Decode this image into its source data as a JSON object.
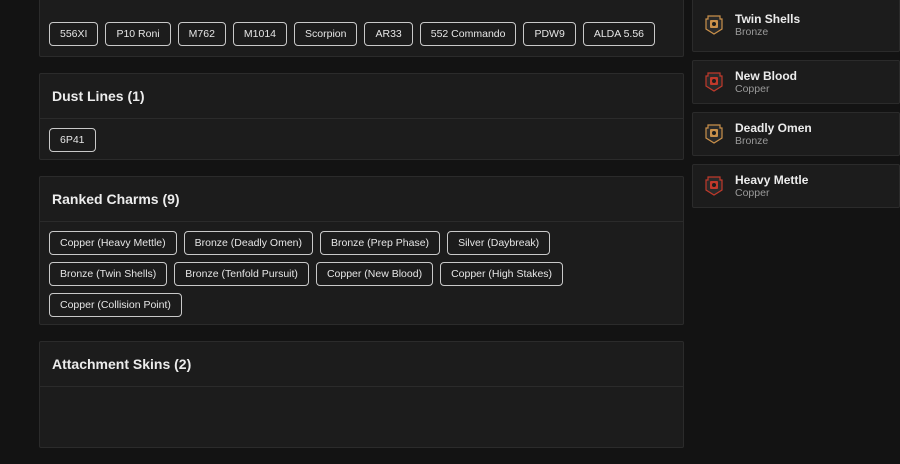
{
  "weapon_chips": [
    "556XI",
    "P10 Roni",
    "M762",
    "M1014",
    "Scorpion",
    "AR33",
    "552 Commando",
    "PDW9",
    "ALDA 5.56"
  ],
  "dust_lines": {
    "title": "Dust Lines (1)",
    "items": [
      "6P41"
    ]
  },
  "ranked_charms": {
    "title": "Ranked Charms (9)",
    "items": [
      "Copper (Heavy Mettle)",
      "Bronze (Deadly Omen)",
      "Bronze (Prep Phase)",
      "Silver (Daybreak)",
      "Bronze (Twin Shells)",
      "Bronze (Tenfold Pursuit)",
      "Copper (New Blood)",
      "Copper (High Stakes)",
      "Copper (Collision Point)"
    ]
  },
  "attachment_skins": {
    "title": "Attachment Skins (2)"
  },
  "right_list": [
    {
      "name": "Twin Shells",
      "tier": "Bronze",
      "icon": "bronze-rank-badge-icon",
      "color": "#c9904a"
    },
    {
      "name": "New Blood",
      "tier": "Copper",
      "icon": "copper-rank-badge-icon",
      "color": "#c0392b"
    },
    {
      "name": "Deadly Omen",
      "tier": "Bronze",
      "icon": "bronze-rank-badge-icon",
      "color": "#c9904a"
    },
    {
      "name": "Heavy Mettle",
      "tier": "Copper",
      "icon": "copper-rank-badge-icon",
      "color": "#c0392b"
    }
  ]
}
